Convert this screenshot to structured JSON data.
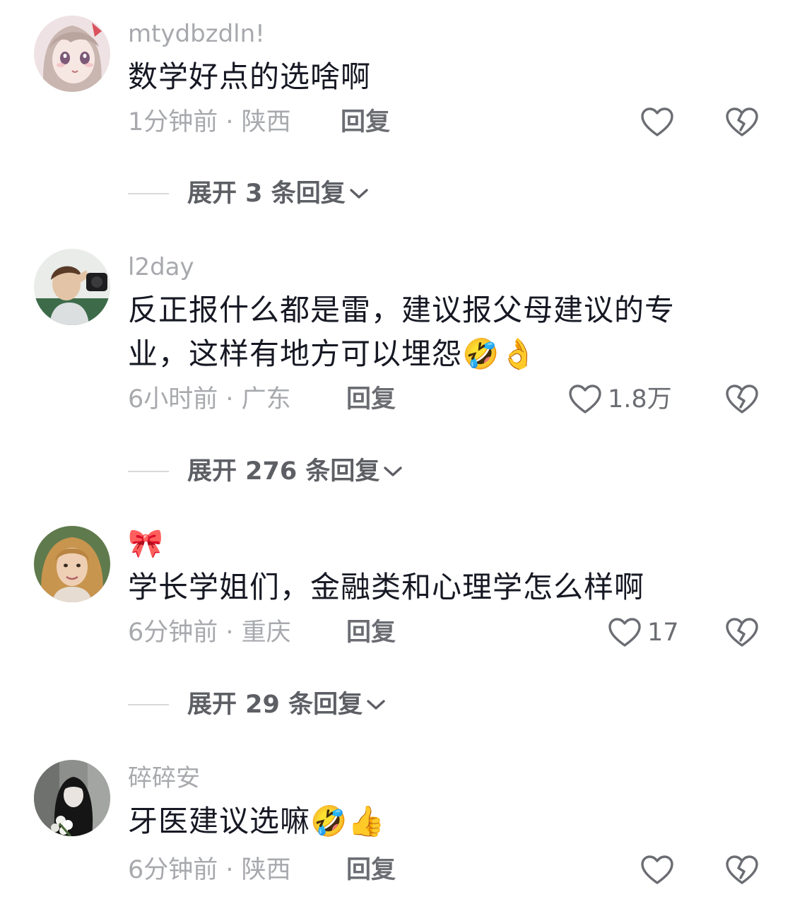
{
  "comments": [
    {
      "username": "mtydbzdln!",
      "text": "数学好点的选啥啊",
      "time_location": "1分钟前 · 陕西",
      "reply_label": "回复",
      "like_count": "",
      "expand_label": "展开 3 条回复",
      "avatar_icon": "anime-girl-avatar"
    },
    {
      "username": "l2day",
      "text": "反正报什么都是雷，建议报父母建议的专业，这样有地方可以埋怨🤣👌",
      "time_location": "6小时前 · 广东",
      "reply_label": "回复",
      "like_count": "1.8万",
      "expand_label": "展开 276 条回复",
      "avatar_icon": "photo-person-avatar"
    },
    {
      "username": "🎀",
      "text": "学长学姐们，金融类和心理学怎么样啊",
      "time_location": "6分钟前 · 重庆",
      "reply_label": "回复",
      "like_count": "17",
      "expand_label": "展开 29 条回复",
      "avatar_icon": "photo-woman-avatar"
    },
    {
      "username": "碎碎安",
      "text": "牙医建议选嘛🤣👍",
      "time_location": "6分钟前 · 陕西",
      "reply_label": "回复",
      "like_count": "",
      "expand_label": "",
      "avatar_icon": "photo-girl-flowers-avatar"
    }
  ],
  "colors": {
    "text_primary": "#161823",
    "text_secondary": "#a7a9ad",
    "reply_button": "#6b6d73",
    "icon_stroke": "#6b6d73"
  },
  "icons": {
    "like": "heart-outline-icon",
    "dislike": "broken-heart-icon",
    "expand": "chevron-down-icon"
  }
}
